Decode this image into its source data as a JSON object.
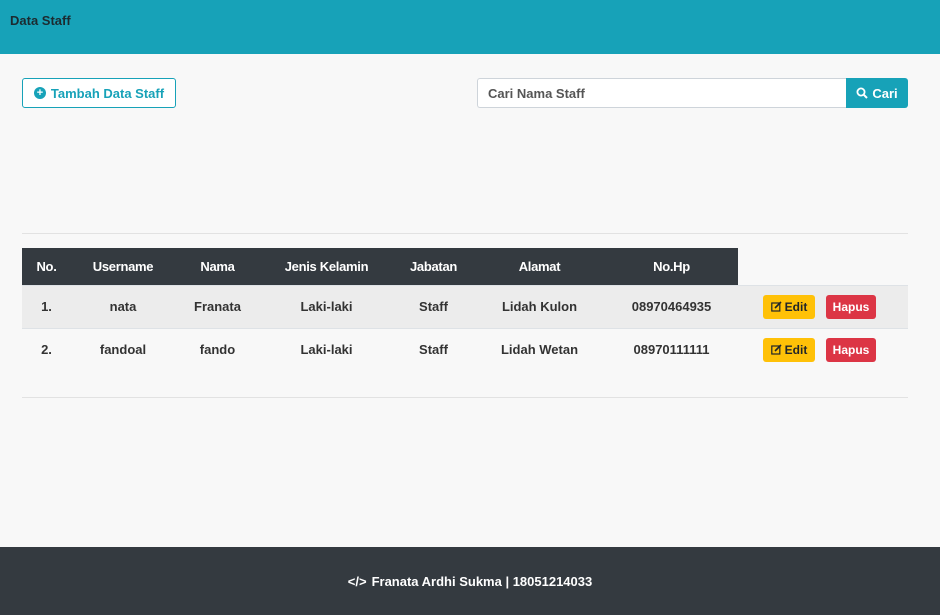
{
  "header": {
    "title": "Data Staff"
  },
  "toolbar": {
    "add_label": "Tambah Data Staff",
    "add_icon": "plus-circle-icon",
    "search_placeholder": "Cari Nama Staff",
    "search_label": "Cari",
    "search_icon": "search-icon"
  },
  "table": {
    "columns": [
      "No.",
      "Username",
      "Nama",
      "Jenis Kelamin",
      "Jabatan",
      "Alamat",
      "No.Hp"
    ],
    "rows": [
      {
        "no": "1.",
        "username": "nata",
        "nama": "Franata",
        "jk": "Laki-laki",
        "jabatan": "Staff",
        "alamat": "Lidah Kulon",
        "hp": "08970464935",
        "edit": "Edit",
        "hapus": "Hapus"
      },
      {
        "no": "2.",
        "username": "fandoal",
        "nama": "fando",
        "jk": "Laki-laki",
        "jabatan": "Staff",
        "alamat": "Lidah Wetan",
        "hp": "08970111111",
        "edit": "Edit",
        "hapus": "Hapus"
      }
    ]
  },
  "footer": {
    "text": "Franata Ardhi Sukma | 18051214033",
    "icon": "code-icon"
  },
  "colors": {
    "primary": "#17a2b8",
    "dark": "#343a40",
    "warning": "#ffc107",
    "danger": "#dc3545"
  }
}
